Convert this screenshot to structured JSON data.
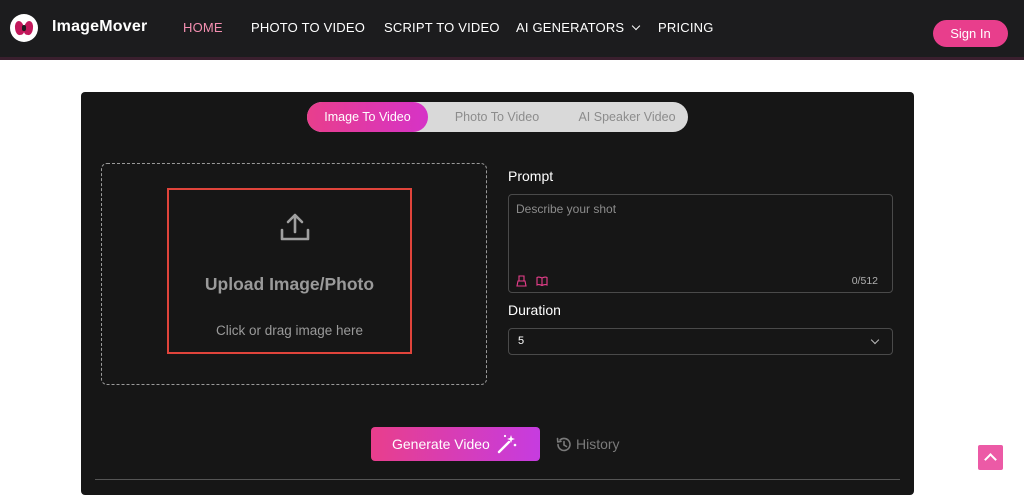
{
  "header": {
    "brand": "ImageMover",
    "nav": [
      {
        "label": "HOME",
        "active": true
      },
      {
        "label": "PHOTO TO VIDEO"
      },
      {
        "label": "SCRIPT TO VIDEO"
      },
      {
        "label": "AI GENERATORS",
        "dropdown": true
      },
      {
        "label": "PRICING"
      }
    ],
    "signin_label": "Sign In"
  },
  "tabs": [
    "Image To Video",
    "Photo To Video",
    "AI Speaker Video"
  ],
  "upload": {
    "title": "Upload Image/Photo",
    "subtitle": "Click or drag image here"
  },
  "prompt": {
    "label": "Prompt",
    "placeholder": "Describe your shot",
    "counter": "0/512"
  },
  "duration": {
    "label": "Duration",
    "value": "5"
  },
  "actions": {
    "generate_label": "Generate Video",
    "history_label": "History"
  },
  "colors": {
    "accent_pink": "#e83e8c",
    "accent_purple": "#c63ce0",
    "nav_bg": "#1c1c1e",
    "card_bg": "#161616",
    "highlight_red": "#e0443b"
  }
}
